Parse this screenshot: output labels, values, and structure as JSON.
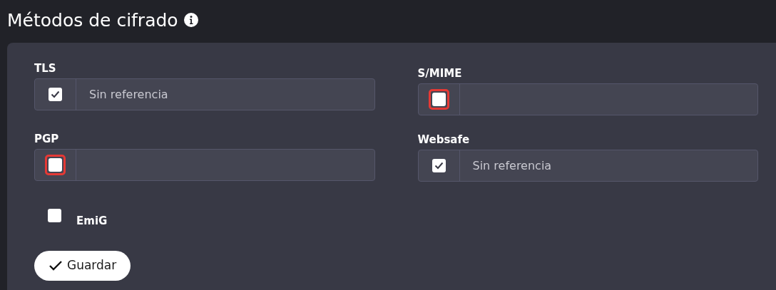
{
  "title": "Métodos de cifrado",
  "columns": [
    [
      {
        "label": "TLS",
        "checked": true,
        "highlighted": false,
        "value": "Sin referencia"
      },
      {
        "label": "PGP",
        "checked": false,
        "highlighted": true
      }
    ],
    [
      {
        "label": "S/MIME",
        "checked": false,
        "highlighted": true
      },
      {
        "label": "Websafe",
        "checked": true,
        "highlighted": false,
        "value": "Sin referencia"
      }
    ]
  ],
  "emig": {
    "label": "EmiG",
    "checked": false
  },
  "save_button": "Guardar"
}
